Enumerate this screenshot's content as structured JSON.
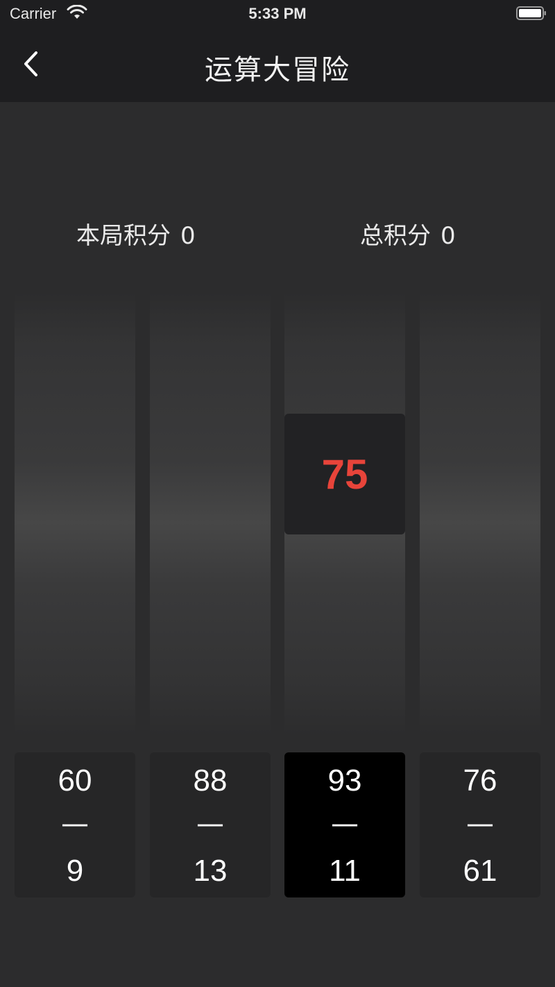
{
  "status_bar": {
    "carrier": "Carrier",
    "time": "5:33 PM",
    "icons": [
      "wifi-icon",
      "battery-icon"
    ]
  },
  "nav": {
    "back_icon": "chevron-left-icon",
    "title": "运算大冒险"
  },
  "scores": {
    "round_label": "本局积分",
    "round_value": "0",
    "total_label": "总积分",
    "total_value": "0"
  },
  "falling_block": {
    "value": "75",
    "color": "#e8443a"
  },
  "cards": [
    {
      "top": "60",
      "op": "—",
      "bottom": "9",
      "selected": false
    },
    {
      "top": "88",
      "op": "—",
      "bottom": "13",
      "selected": false
    },
    {
      "top": "93",
      "op": "—",
      "bottom": "11",
      "selected": true
    },
    {
      "top": "76",
      "op": "—",
      "bottom": "61",
      "selected": false
    }
  ],
  "colors": {
    "background": "#2c2c2d",
    "bar": "#1e1e20",
    "card": "#262627",
    "card_selected": "#000000"
  }
}
